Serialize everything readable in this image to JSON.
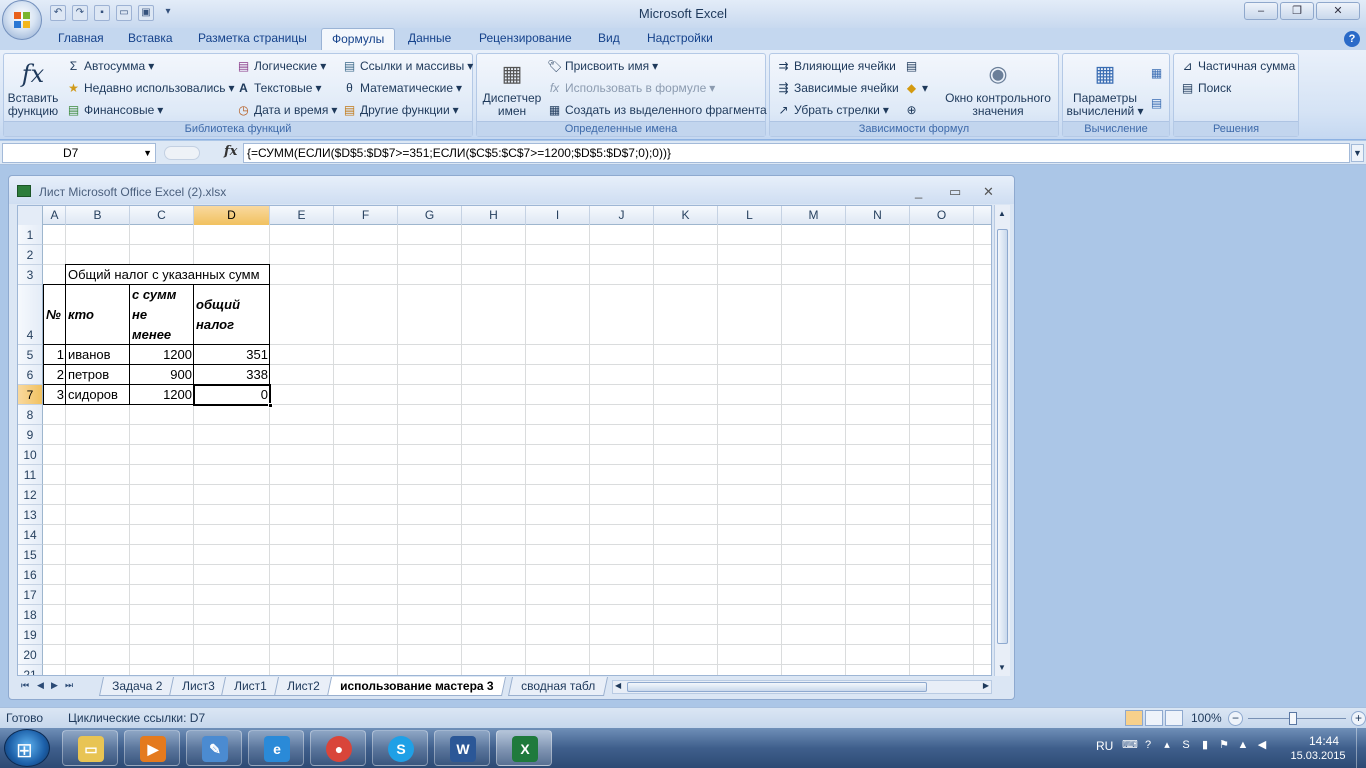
{
  "app": {
    "title": "Microsoft Excel",
    "quick_access": [
      "undo",
      "redo",
      "save",
      "print",
      "window"
    ]
  },
  "ribbon_tabs": [
    "Главная",
    "Вставка",
    "Разметка страницы",
    "Формулы",
    "Данные",
    "Рецензирование",
    "Вид",
    "Надстройки"
  ],
  "active_tab": "Формулы",
  "groups": {
    "functions": {
      "label": "Библиотека функций",
      "insert": "Вставить функцию",
      "insert_l1": "Вставить",
      "insert_l2": "функцию",
      "autosum": "Автосумма",
      "recent": "Недавно использовались",
      "financial": "Финансовые",
      "logical": "Логические",
      "text": "Текстовые",
      "datetime": "Дата и время",
      "lookup": "Ссылки и массивы",
      "math": "Математические",
      "more": "Другие функции"
    },
    "names": {
      "label": "Определенные имена",
      "manager_l1": "Диспетчер",
      "manager_l2": "имен",
      "define": "Присвоить имя",
      "use": "Использовать в формуле",
      "create": "Создать из выделенного фрагмента"
    },
    "audit": {
      "label": "Зависимости формул",
      "precedents": "Влияющие ячейки",
      "dependents": "Зависимые ячейки",
      "remove": "Убрать стрелки",
      "watch_l1": "Окно контрольного",
      "watch_l2": "значения"
    },
    "calc": {
      "label": "Вычисление",
      "options_l1": "Параметры",
      "options_l2": "вычислений"
    },
    "solutions": {
      "label": "Решения",
      "partial": "Частичная сумма",
      "search": "Поиск"
    }
  },
  "formula_bar": {
    "name_box": "D7",
    "formula": "{=СУММ(ЕСЛИ($D$5:$D$7>=351;ЕСЛИ($C$5:$C$7>=1200;$D$5:$D$7;0);0))}"
  },
  "workbook": {
    "title": "Лист Microsoft Office Excel (2).xlsx",
    "columns": [
      "A",
      "B",
      "C",
      "D",
      "E",
      "F",
      "G",
      "H",
      "I",
      "J",
      "K",
      "L",
      "M",
      "N",
      "O"
    ],
    "rows": [
      "1",
      "2",
      "3",
      "4",
      "5",
      "6",
      "7",
      "8",
      "9",
      "10",
      "11",
      "12",
      "13",
      "14",
      "15",
      "16",
      "17",
      "18",
      "19",
      "20",
      "21"
    ],
    "selected_col": "D",
    "selected_row": "7",
    "cells": {
      "b3": "Общий налог с указанных сумм",
      "a4": "№",
      "b4": "кто",
      "c4_l1": "с сумм",
      "c4_l2": "не",
      "c4_l3": "менее",
      "d4_l1": "общий",
      "d4_l2": "налог",
      "a5": "1",
      "b5": "иванов",
      "c5": "1200",
      "d5": "351",
      "a6": "2",
      "b6": "петров",
      "c6": "900",
      "d6": "338",
      "a7": "3",
      "b7": "сидоров",
      "c7": "1200",
      "d7": "0"
    },
    "sheets": [
      "Задача 2",
      "Лист3",
      "Лист1",
      "Лист2",
      "использование мастера 3",
      "сводная табл"
    ],
    "active_sheet": "использование мастера 3"
  },
  "status": {
    "ready": "Готово",
    "circular": "Циклические ссылки: D7",
    "zoom": "100%"
  },
  "taskbar": {
    "apps": [
      "explorer",
      "media",
      "paint",
      "ie",
      "chrome",
      "skype",
      "word",
      "excel"
    ],
    "lang": "RU",
    "time": "14:44",
    "date": "15.03.2015"
  }
}
